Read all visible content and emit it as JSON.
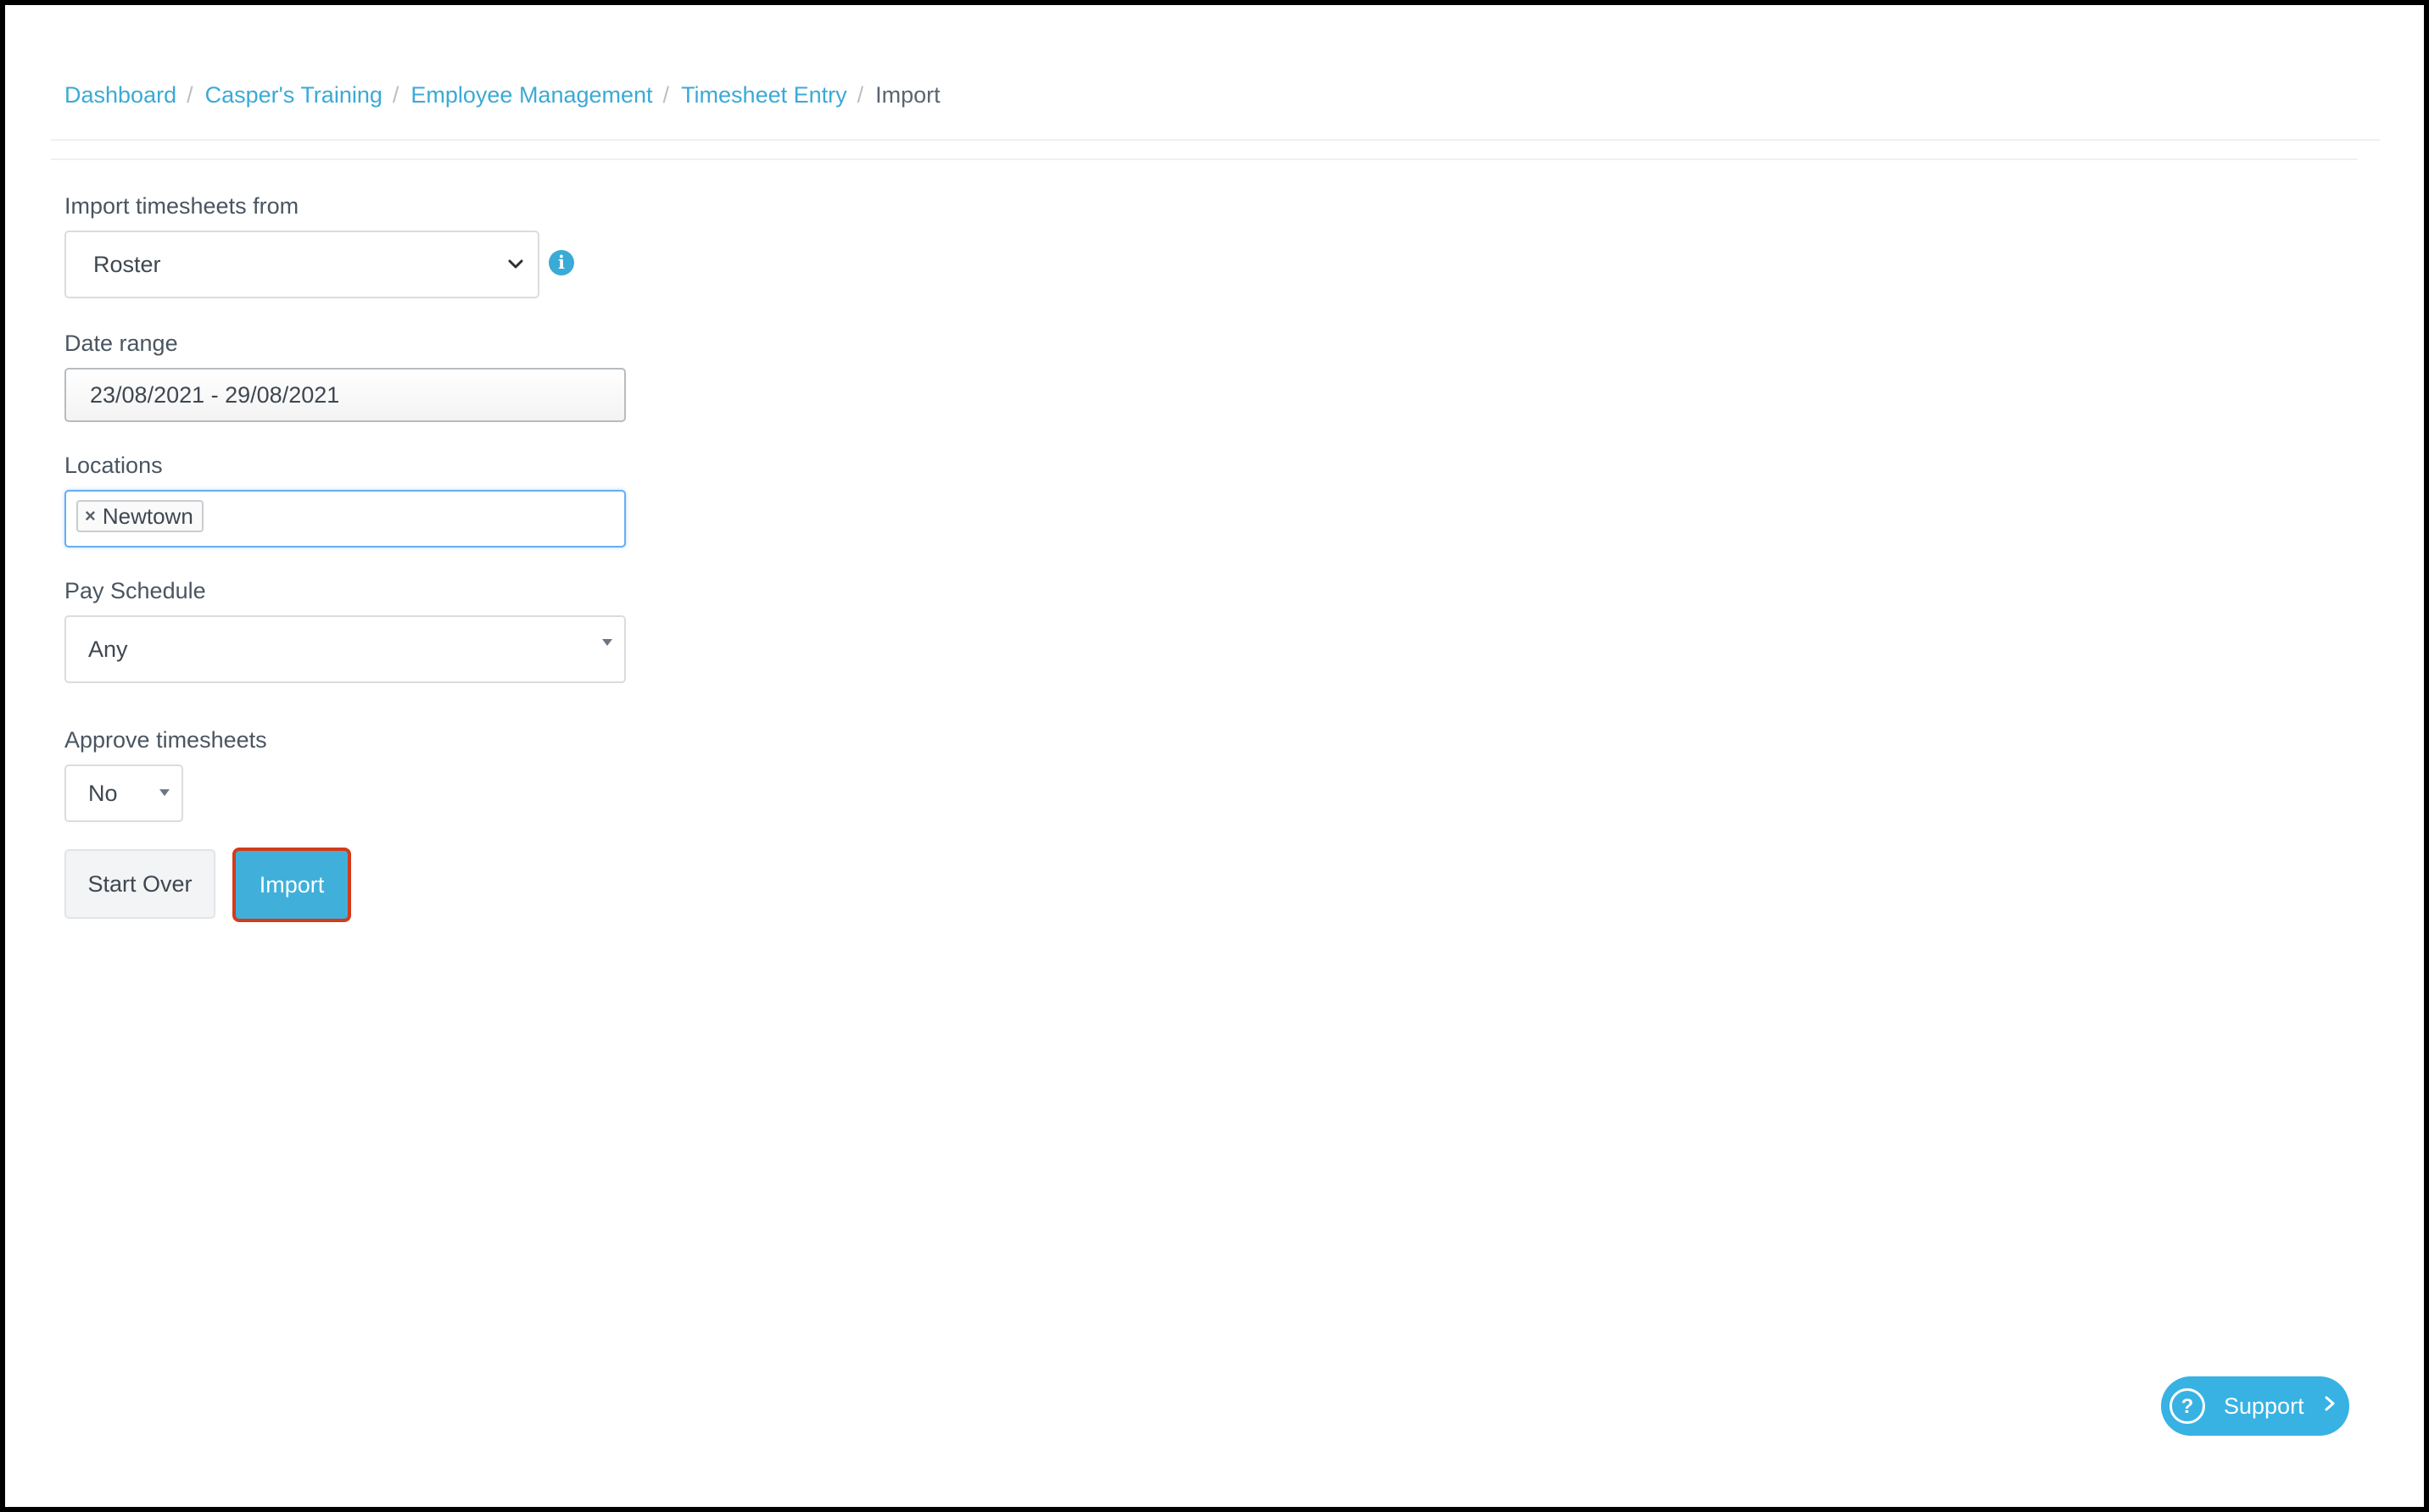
{
  "breadcrumb": {
    "items": [
      "Dashboard",
      "Casper's Training",
      "Employee Management",
      "Timesheet Entry"
    ],
    "separator": "/",
    "current": "Import"
  },
  "form": {
    "import_from": {
      "label": "Import timesheets from",
      "value": "Roster",
      "info_icon": "info-icon"
    },
    "date_range": {
      "label": "Date range",
      "value": "23/08/2021 -  29/08/2021"
    },
    "locations": {
      "label": "Locations",
      "tags": [
        "Newtown"
      ],
      "remove_glyph": "×"
    },
    "pay_schedule": {
      "label": "Pay Schedule",
      "value": "Any"
    },
    "approve": {
      "label": "Approve timesheets",
      "value": "No"
    }
  },
  "buttons": {
    "start_over": "Start Over",
    "import": "Import"
  },
  "support": {
    "icon_glyph": "?",
    "label": "Support"
  },
  "colors": {
    "link": "#3aaad6",
    "primary_button": "#40b0da",
    "highlight_border": "#d33b1a",
    "support": "#37b2e3"
  }
}
